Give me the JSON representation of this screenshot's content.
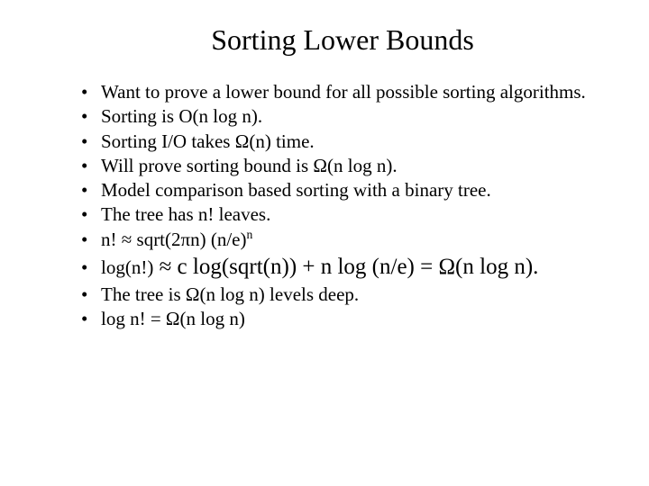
{
  "title": "Sorting Lower Bounds",
  "bullets": {
    "b0": "Want to prove a lower bound for all possible sorting algorithms.",
    "b1": "Sorting is O(n log n).",
    "b2": "Sorting I/O takes Ω(n) time.",
    "b3": "Will prove sorting bound is Ω(n log n).",
    "b4": "Model comparison based sorting with a binary tree.",
    "b5": "The tree has n! leaves.",
    "b6_pre": "n! ≈ sqrt(2πn) (n/e)",
    "b6_sup": "n",
    "b7_prefix": "log(n!)",
    "b7_rest": " ≈ c log(sqrt(n)) + n log (n/e) = Ω(n log n).",
    "b8": "The tree is Ω(n log n) levels deep.",
    "b9": "log n! = Ω(n log n)"
  }
}
